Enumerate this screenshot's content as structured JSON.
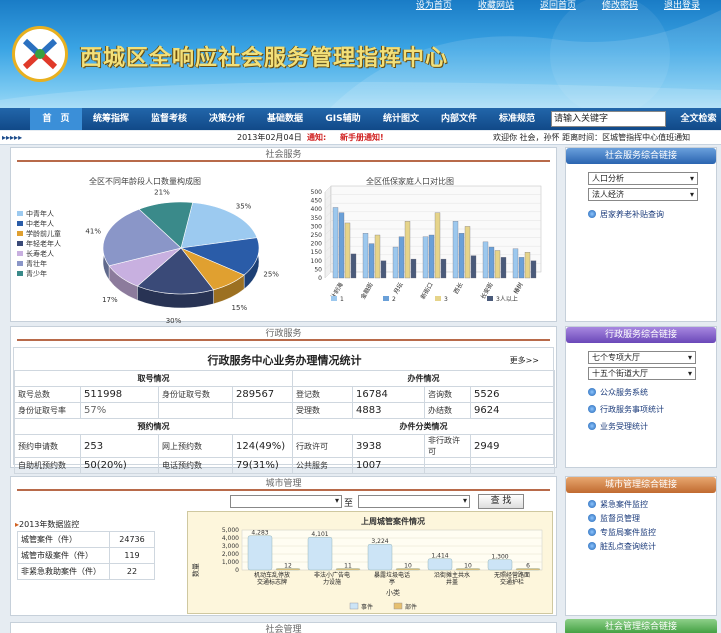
{
  "top_links": [
    "设为首页",
    "收藏网站",
    "返回首页",
    "修改密码",
    "退出登录"
  ],
  "site_title": "西城区全响应社会服务管理指挥中心",
  "nav": [
    "首　页",
    "统筹指挥",
    "监督考核",
    "决策分析",
    "基础数据",
    "GIS辅助",
    "统计图文",
    "内部文件",
    "标准规范"
  ],
  "search": {
    "value": "请输入关键字",
    "button": "全文检索"
  },
  "ticker": {
    "left": "2013年02月04日",
    "notice1": "通知:",
    "notice2": "新手册通知!",
    "right": "欢迎你 社会，孙怀 距离时间：区城管指挥中心值班通知"
  },
  "social": {
    "panel_title": "社会服务",
    "pie": {
      "title": "全区不同年龄段人口数量构成图"
    },
    "bar": {
      "title": "全区低保家庭人口对比图"
    }
  },
  "chart_data": [
    {
      "type": "pie",
      "title": "全区不同年龄段人口数量构成图",
      "categories": [
        "中青年人",
        "中老年人",
        "学龄前儿童",
        "年轻老年人",
        "长寿老人",
        "青壮年",
        "青少年"
      ],
      "values": [
        35,
        25,
        15,
        30,
        17,
        41,
        21
      ],
      "labels": [
        "35%",
        "25%",
        "15%",
        "30%",
        "17%",
        "41%",
        "21%"
      ],
      "colors": [
        "#9ccaf0",
        "#2a5ca8",
        "#e0a030",
        "#3a4a78",
        "#c8b0e0",
        "#8a96c8",
        "#3a8a8a"
      ]
    },
    {
      "type": "bar",
      "title": "全区低保家庭人口对比图",
      "categories": [
        "什刹海",
        "金融街",
        "月坛",
        "新街口",
        "西长",
        "长安街",
        "椿树"
      ],
      "series": [
        {
          "name": "1",
          "color": "#9cc8ee",
          "values": [
            410,
            260,
            180,
            240,
            330,
            210,
            170
          ]
        },
        {
          "name": "2",
          "color": "#6aa0d8",
          "values": [
            380,
            200,
            240,
            250,
            260,
            180,
            120
          ]
        },
        {
          "name": "3",
          "color": "#e6d48a",
          "values": [
            320,
            250,
            330,
            380,
            300,
            160,
            150
          ]
        },
        {
          "name": "3人以上",
          "color": "#4a5a7a",
          "values": [
            140,
            100,
            110,
            110,
            130,
            120,
            100
          ]
        }
      ],
      "ylim": [
        0,
        500
      ],
      "yticks": [
        0,
        50,
        100,
        150,
        200,
        250,
        300,
        350,
        400,
        450,
        500
      ]
    },
    {
      "type": "bar",
      "title": "上周城管案件情况",
      "xlabel": "小类",
      "ylabel": "数量",
      "categories": [
        "机动车乱停放交通标志牌",
        "非法小广告电力设施",
        "暴露垃圾电话亭",
        "沿街摊主共水井盖",
        "无照经营路面交通护栏"
      ],
      "series": [
        {
          "name": "事件",
          "color": "#cce4f6",
          "values": [
            4283,
            4101,
            3224,
            1414,
            1300
          ]
        },
        {
          "name": "部件",
          "color": "#e6c070",
          "values": [
            12,
            11,
            10,
            10,
            6
          ]
        }
      ],
      "ylim": [
        0,
        5000
      ],
      "yticks": [
        0,
        1000,
        2000,
        3000,
        4000,
        5000
      ]
    }
  ],
  "admin": {
    "panel_title": "行政服务",
    "table_title": "行政服务中心业务办理情况统计",
    "more": "更多>>",
    "sec1": "取号情况",
    "sec2": "办件情况",
    "sec3": "预约情况",
    "sec4": "办件分类情况",
    "r1": [
      "取号总数",
      "511998",
      "身份证取号数",
      "289567",
      "登记数",
      "16784",
      "咨询数",
      "5526"
    ],
    "r2": [
      "身份证取号率",
      "57%",
      "受理数",
      "4883",
      "办结数",
      "9624"
    ],
    "r3": [
      "预约申请数",
      "253",
      "网上预约数",
      "124(49%)",
      "行政许可",
      "3938",
      "非行政许可",
      "2949"
    ],
    "r4": [
      "自助机预约数",
      "50(20%)",
      "电话预约数",
      "79(31%)",
      "公共服务",
      "1007"
    ]
  },
  "city": {
    "panel_title": "城市管理",
    "search_to": "至",
    "search_btn": "查 找",
    "stat_title": "2013年数据监控",
    "rows": [
      [
        "城管案件（件）",
        "24736"
      ],
      [
        "城管市级案件（件）",
        "119"
      ],
      [
        "非紧急救助案件（件）",
        "22"
      ]
    ],
    "chart_title": "上周城管案件情况"
  },
  "bottom_title": "社会管理",
  "side": {
    "s1": {
      "title": "社会服务综合链接",
      "sel1": "人口分析",
      "sel2": "法人经济",
      "link": "居家养老补贴查询"
    },
    "s2": {
      "title": "行政服务综合链接",
      "sel1": "七个专项大厅",
      "sel2": "十五个街道大厅",
      "links": [
        "公众服务系统",
        "行政服务事项统计",
        "业务受理统计"
      ]
    },
    "s3": {
      "title": "城市管理综合链接",
      "links": [
        "紧急案件监控",
        "监督员管理",
        "专监局案件监控",
        "脏乱点查询统计"
      ]
    },
    "s4": {
      "title": "社会管理综合链接"
    }
  }
}
